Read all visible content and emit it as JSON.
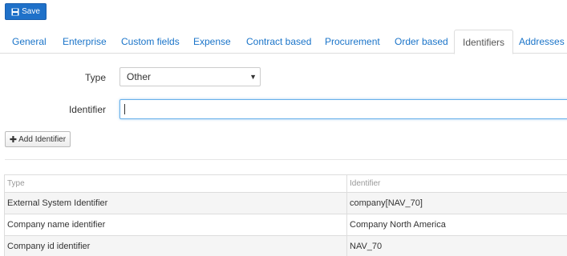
{
  "toolbar": {
    "save_label": "Save",
    "save_icon": "save-icon"
  },
  "tabs": [
    {
      "label": "General"
    },
    {
      "label": "Enterprise"
    },
    {
      "label": "Custom fields"
    },
    {
      "label": "Expense"
    },
    {
      "label": "Contract based"
    },
    {
      "label": "Procurement"
    },
    {
      "label": "Order based"
    },
    {
      "label": "Identifiers",
      "active": true
    },
    {
      "label": "Addresses"
    }
  ],
  "form": {
    "type_label": "Type",
    "type_value": "Other",
    "identifier_label": "Identifier",
    "identifier_value": ""
  },
  "add_button": {
    "label": "Add Identifier",
    "icon": "plus-icon"
  },
  "table": {
    "headers": [
      "Type",
      "Identifier"
    ],
    "rows": [
      [
        "External System Identifier",
        "company[NAV_70]"
      ],
      [
        "Company name identifier",
        "Company North America"
      ],
      [
        "Company id identifier",
        "NAV_70"
      ]
    ]
  },
  "colors": {
    "primary": "#1f71c9",
    "link": "#1a74c9",
    "focus": "#66afe9",
    "row_stripe": "#f5f5f5"
  }
}
